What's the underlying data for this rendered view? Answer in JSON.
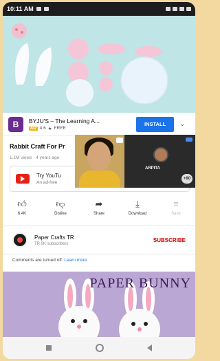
{
  "status_bar": {
    "time": "10:11 AM"
  },
  "video": {
    "description_icons": [
      "paper-leaf-shape",
      "paper-circle-shape"
    ]
  },
  "ad": {
    "logo_letter": "B",
    "title": "BYJU'S – The Learning A...",
    "rating_badge": "AD",
    "rating": "4.6",
    "price": "FREE",
    "install_label": "INSTALL"
  },
  "video_info": {
    "title": "Rabbit Craft For Pr",
    "meta": "1.1M views · 4 years ago"
  },
  "promo": {
    "line1": "Try YouTu",
    "line2": "An ad-free"
  },
  "call": {
    "participant_name": "ARPITA",
    "more_count": "+80"
  },
  "actions": [
    {
      "label": "6.4K",
      "icon": "thumb-up-icon"
    },
    {
      "label": "Dislike",
      "icon": "thumb-down-icon"
    },
    {
      "label": "Share",
      "icon": "share-icon"
    },
    {
      "label": "Download",
      "icon": "download-icon"
    },
    {
      "label": "Save",
      "icon": "save-icon"
    }
  ],
  "channel": {
    "name": "Paper Crafts TR",
    "subscribers": "TR 9K subscribers",
    "subscribe_label": "SUBSCRIBE"
  },
  "comments": {
    "text": "Comments are turned off.",
    "link": "Learn more"
  },
  "thumbnail": {
    "title": "PAPER BUNNY"
  },
  "colors": {
    "install_blue": "#1a73e8",
    "subscribe_red": "#cc0000",
    "video_bg": "#bfe5e6",
    "thumbnail_bg": "#bba7d3"
  }
}
